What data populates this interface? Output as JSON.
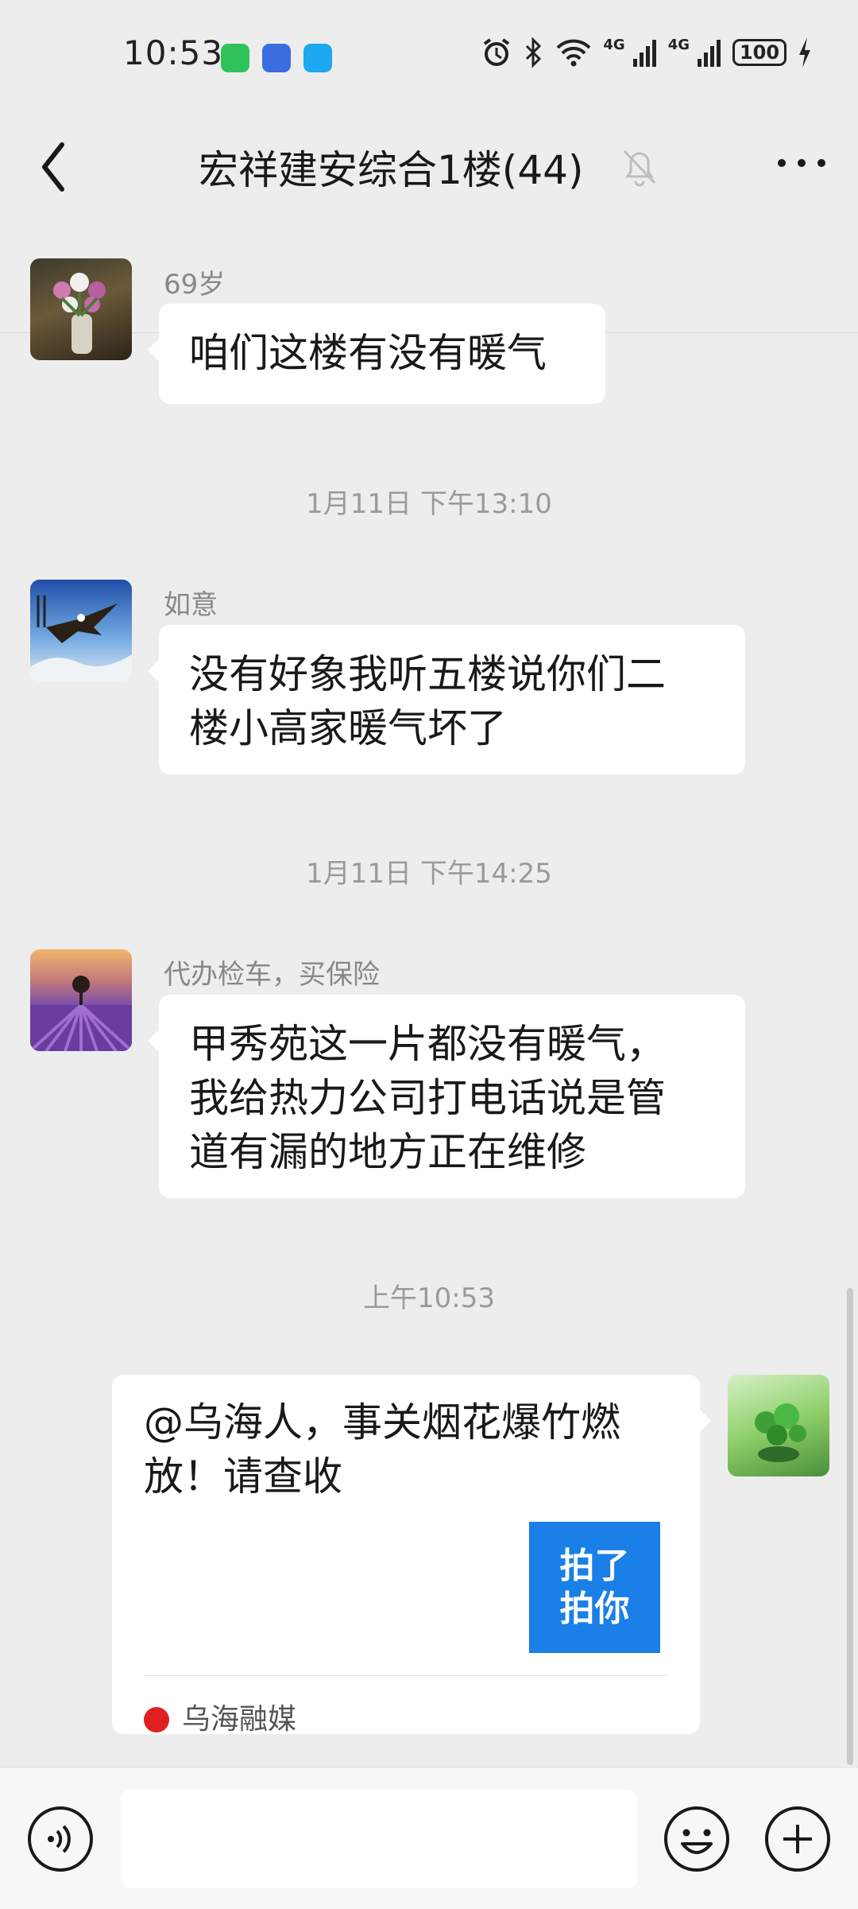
{
  "status_bar": {
    "time": "10:53",
    "signal1_label": "4G",
    "signal2_label": "4G",
    "battery": "100"
  },
  "header": {
    "title": "宏祥建安综合1楼(44)",
    "back_icon": "chevron-left-icon",
    "mute_icon": "bell-off-icon",
    "more_icon": "more-dots-icon"
  },
  "messages": [
    {
      "sender": "69岁",
      "text": "咱们这楼有没有暖气"
    },
    {
      "timestamp": "1月11日 下午13:10"
    },
    {
      "sender": "如意",
      "lines": [
        "没有好象我听五楼说你们二",
        "楼小高家暖气坏了"
      ]
    },
    {
      "timestamp": "1月11日 下午14:25"
    },
    {
      "sender": "代办检车，买保险",
      "lines": [
        "甲秀苑这一片都没有暖气，",
        "我给热力公司打电话说是管",
        "道有漏的地方正在维修"
      ]
    },
    {
      "timestamp": "上午10:53"
    },
    {
      "outgoing": true,
      "card": {
        "lines": [
          "@乌海人，事关烟花爆竹燃",
          "放！请查收"
        ],
        "thumb_lines": [
          "拍了",
          "拍你"
        ],
        "source": "乌海融媒"
      }
    }
  ],
  "input_bar": {
    "placeholder": "",
    "voice_icon": "voice-icon",
    "emoji_icon": "emoji-icon",
    "plus_icon": "plus-icon"
  },
  "colors": {
    "background": "#ededed",
    "bubble": "#ffffff",
    "timestamp": "#9a9a9a",
    "thumb": "#1a7fe6"
  }
}
